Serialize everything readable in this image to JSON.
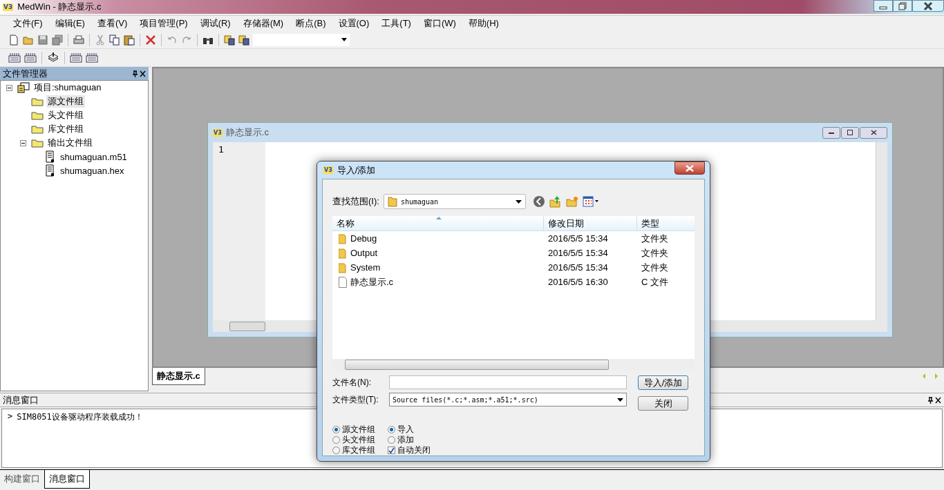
{
  "window": {
    "logo": "V3",
    "title": "MedWin - 静态显示.c"
  },
  "menu": [
    "文件(F)",
    "编辑(E)",
    "查看(V)",
    "项目管理(P)",
    "调试(R)",
    "存储器(M)",
    "断点(B)",
    "设置(O)",
    "工具(T)",
    "窗口(W)",
    "帮助(H)"
  ],
  "file_manager": {
    "title": "文件管理器",
    "tree": [
      {
        "label": "项目:shumaguan",
        "kind": "project",
        "expanded": true,
        "selected": false,
        "children": [
          {
            "label": "源文件组",
            "kind": "folder",
            "selected": true
          },
          {
            "label": "头文件组",
            "kind": "folder",
            "selected": false
          },
          {
            "label": "库文件组",
            "kind": "folder",
            "selected": false
          },
          {
            "label": "输出文件组",
            "kind": "folder",
            "expanded": true,
            "selected": false,
            "children": [
              {
                "label": "shumaguan.m51",
                "kind": "file",
                "selected": false
              },
              {
                "label": "shumaguan.hex",
                "kind": "file",
                "selected": false
              }
            ]
          }
        ]
      }
    ]
  },
  "editor": {
    "logo": "V3",
    "title": "静态显示.c",
    "line_numbers": [
      "1"
    ]
  },
  "document_tabs": [
    {
      "label": "静态显示.c",
      "selected": true
    }
  ],
  "message_window": {
    "title": "消息窗口",
    "lines": [
      {
        "prompt": ">",
        "text": "SIM8051设备驱动程序装载成功！"
      }
    ]
  },
  "bottom_tabs": [
    {
      "label": "构建窗口",
      "selected": false
    },
    {
      "label": "消息窗口",
      "selected": true
    }
  ],
  "dialog": {
    "logo": "V3",
    "title": "导入/添加",
    "look_in_label": "查找范围(I):",
    "look_in_value": "shumaguan",
    "columns": [
      "名称",
      "修改日期",
      "类型"
    ],
    "rows": [
      {
        "kind": "folder",
        "name": "Debug",
        "date": "2016/5/5 15:34",
        "type": "文件夹"
      },
      {
        "kind": "folder",
        "name": "Output",
        "date": "2016/5/5 15:34",
        "type": "文件夹"
      },
      {
        "kind": "folder",
        "name": "System",
        "date": "2016/5/5 15:34",
        "type": "文件夹"
      },
      {
        "kind": "file",
        "name": "静态显示.c",
        "date": "2016/5/5 16:30",
        "type": "C 文件"
      }
    ],
    "file_name_label": "文件名(N):",
    "file_type_label": "文件类型(T):",
    "file_type_value": "Source files(*.c;*.asm;*.a51;*.src)",
    "buttons": [
      "导入/添加",
      "关闭"
    ],
    "group_options": [
      {
        "label": "源文件组",
        "selected": true
      },
      {
        "label": "头文件组",
        "selected": false
      },
      {
        "label": "库文件组",
        "selected": false
      }
    ],
    "mode_options": [
      {
        "label": "导入",
        "selected": true
      },
      {
        "label": "添加",
        "selected": false
      }
    ],
    "auto_close": {
      "label": "自动关闭",
      "checked": true
    }
  }
}
